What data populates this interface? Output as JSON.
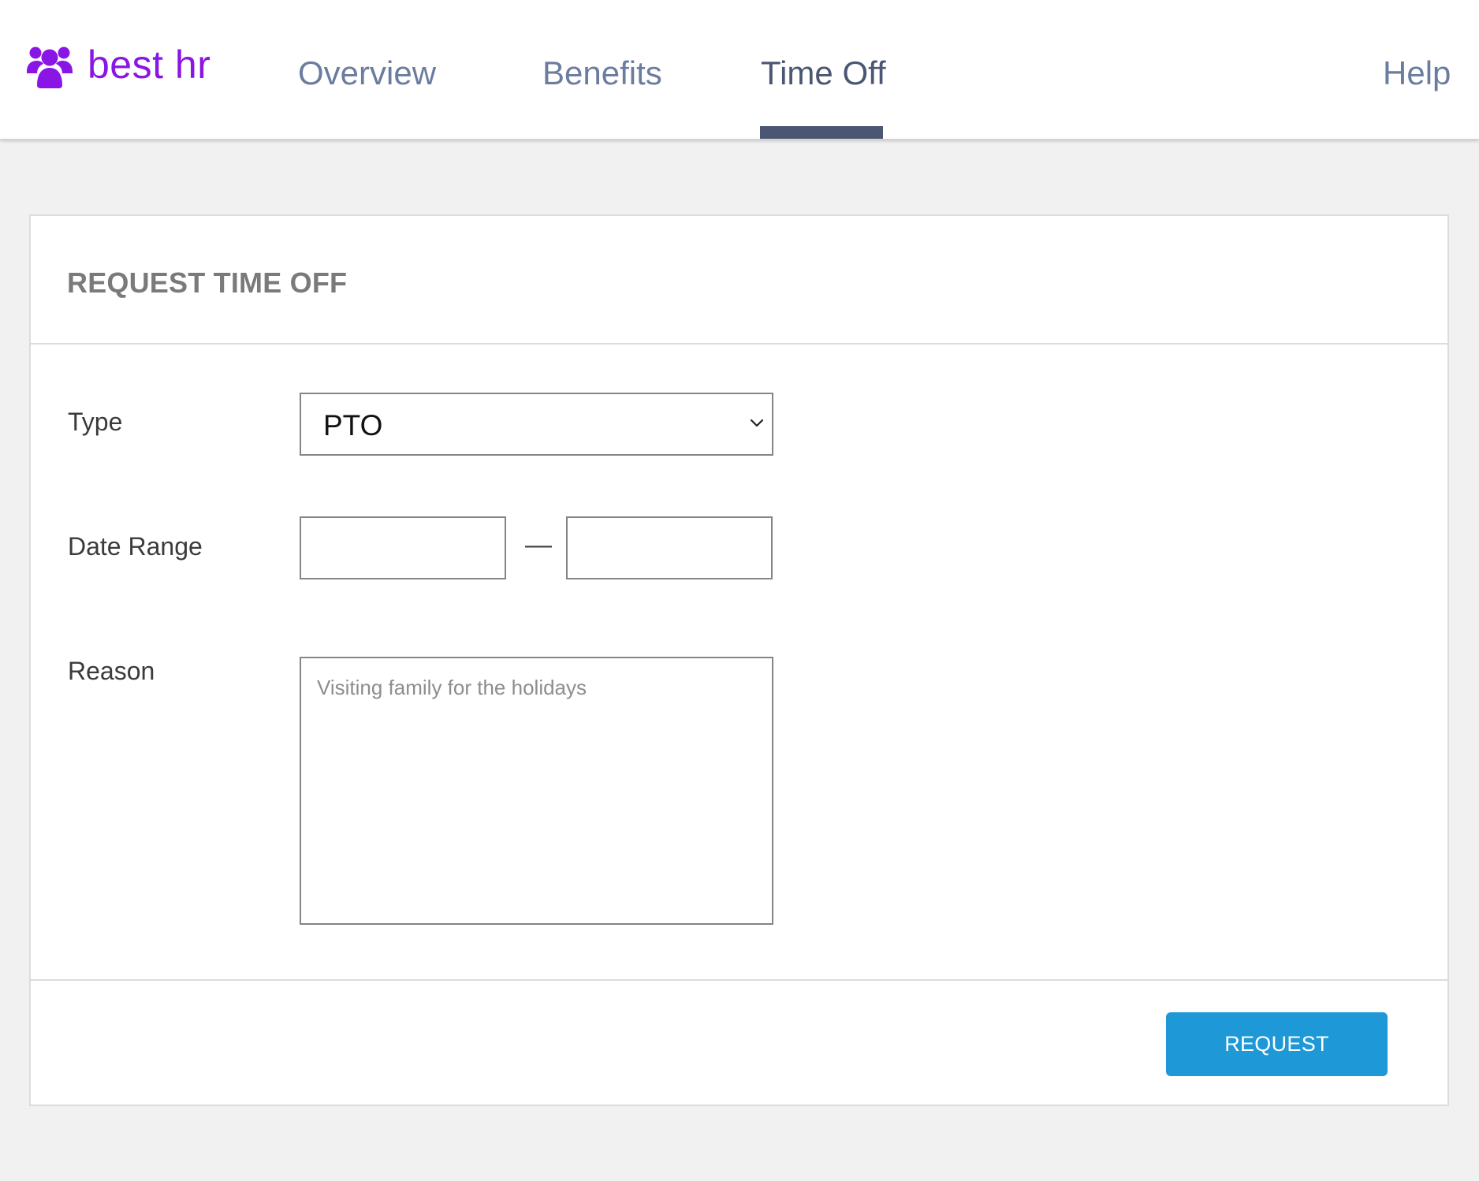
{
  "brand": {
    "name": "best hr",
    "icon": "users-group-icon",
    "color": "#8a16e6"
  },
  "nav": {
    "items": [
      {
        "label": "Overview",
        "active": false
      },
      {
        "label": "Benefits",
        "active": false
      },
      {
        "label": "Time Off",
        "active": true
      },
      {
        "label": "Help",
        "active": false
      }
    ]
  },
  "form": {
    "title": "REQUEST TIME OFF",
    "type": {
      "label": "Type",
      "value": "PTO",
      "icon": "chevron-down-icon"
    },
    "date_range": {
      "label": "Date Range",
      "separator": "—",
      "start_value": "",
      "end_value": ""
    },
    "reason": {
      "label": "Reason",
      "value": "",
      "placeholder": "Visiting family for the holidays"
    },
    "submit_label": "REQUEST",
    "submit_color": "#1e98d7"
  }
}
